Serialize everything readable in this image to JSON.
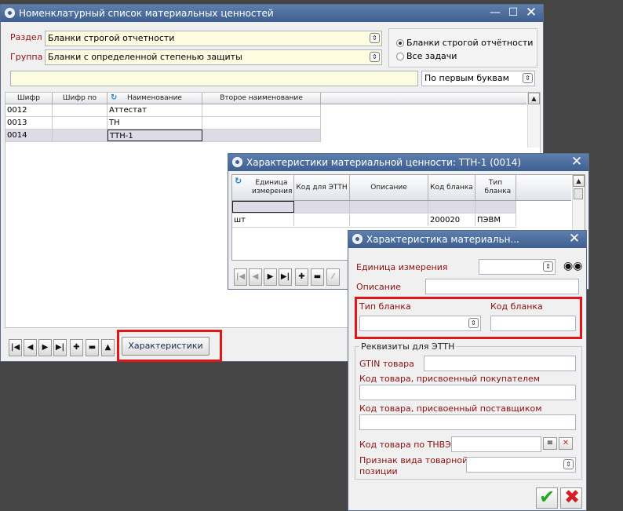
{
  "main": {
    "title": "Номенклатурный список материальных ценностей",
    "razdel_label": "Раздел",
    "razdel_value": "Бланки строгой отчетности",
    "gruppa_label": "Группа",
    "gruppa_value": "Бланки с определенной степенью защиты",
    "radio_1": "Бланки строгой отчётности",
    "radio_2": "Все задачи",
    "search_value": "",
    "search_mode": "По первым буквам",
    "columns": [
      "Шифр",
      "Шифр по",
      "Наименование",
      "Второе наименование"
    ],
    "rows": [
      {
        "code": "0012",
        "code2": "",
        "name": "Аттестат",
        "name2": ""
      },
      {
        "code": "0013",
        "code2": "",
        "name": "ТН",
        "name2": ""
      },
      {
        "code": "0014",
        "code2": "",
        "name": "ТТН-1",
        "name2": ""
      }
    ],
    "characteristics_button": "Характеристики"
  },
  "char_win": {
    "title": "Характеристики материальной ценности: ТТН-1 (0014)",
    "columns": [
      "Единица измерения",
      "Код для ЭТТН",
      "Описание",
      "Код бланка",
      "Тип бланка"
    ],
    "rows": [
      {
        "unit": "",
        "ettn": "",
        "desc": "",
        "code": "",
        "type": ""
      },
      {
        "unit": "шт",
        "ettn": "",
        "desc": "",
        "code": "200020",
        "type": "ПЭВМ"
      }
    ]
  },
  "detail_win": {
    "title": "Характеристика материальн...",
    "unit_label": "Единица измерения",
    "unit_value": "",
    "desc_label": "Описание",
    "desc_value": "",
    "type_label": "Тип бланка",
    "type_value": "",
    "code_label": "Код бланка",
    "code_value": "",
    "ettn_group": "Реквизиты для ЭТТН",
    "gtin_label": "GTIN товара",
    "gtin_value": "",
    "buyer_code_label": "Код товара, присвоенный покупателем",
    "buyer_code_value": "",
    "supplier_code_label": "Код товара, присвоенный поставщиком",
    "supplier_code_value": "",
    "tnved_label": "Код товара по ТНВЭД",
    "tnved_value": "",
    "sign_label_1": "Признак вида товарной",
    "sign_label_2": "позиции",
    "sign_value": ""
  },
  "colors": {
    "titlebar": "#4a6c9e",
    "highlight": "#e0161b",
    "label": "#8a1010",
    "ok": "#1faa1f",
    "cancel": "#d21f26"
  }
}
